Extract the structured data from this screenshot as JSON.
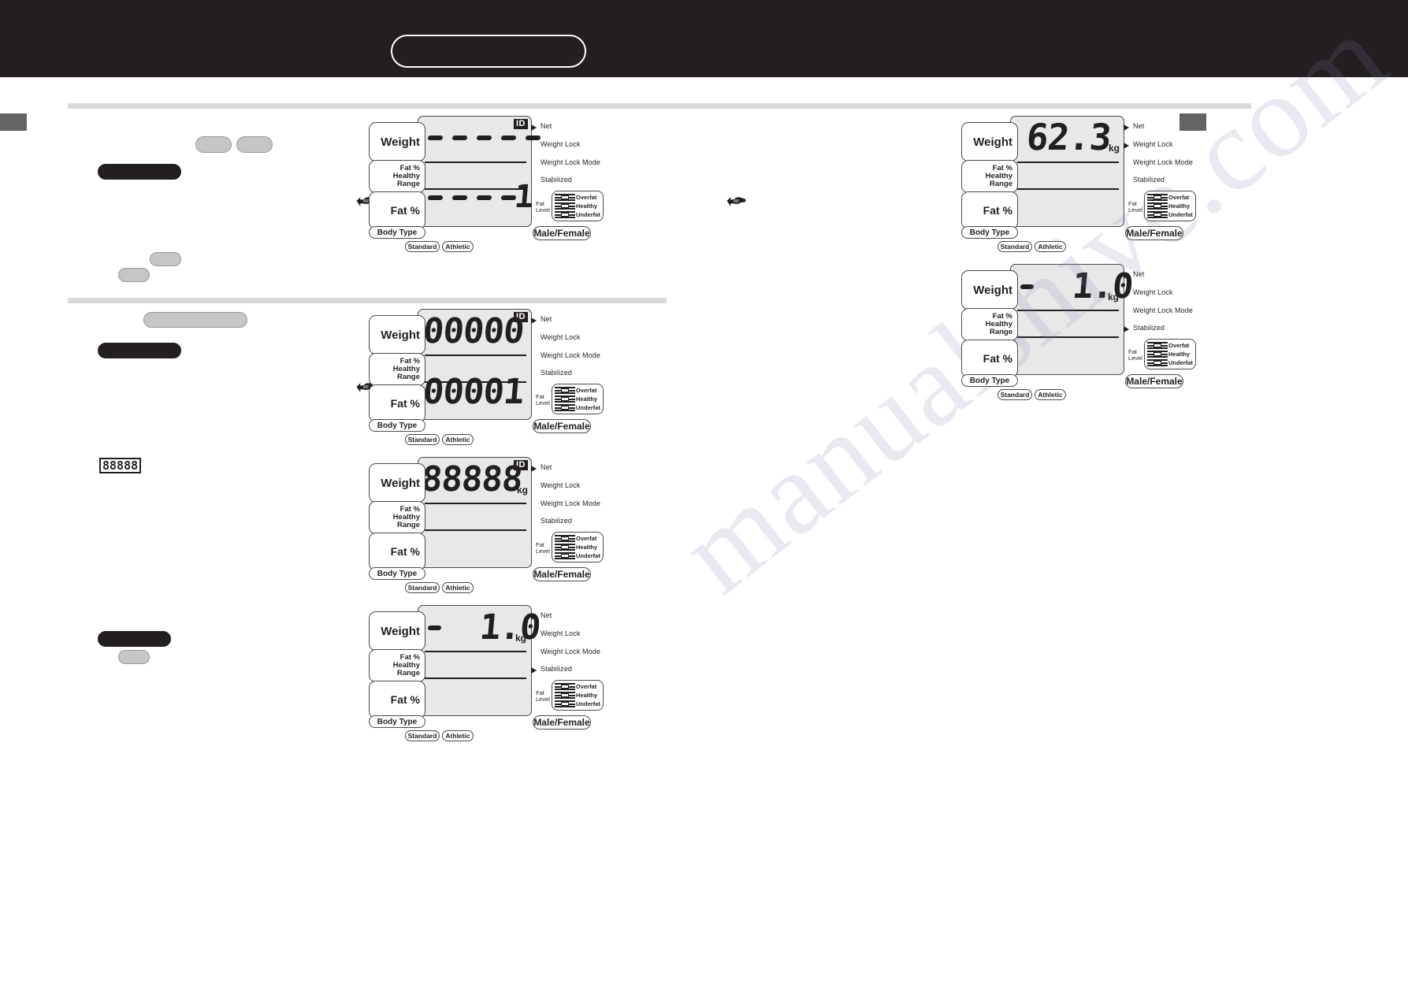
{
  "header": {
    "title": "",
    "title_box_label": "",
    "bg_color": "#231f20"
  },
  "page_marks": {
    "left_oval": "",
    "right_oval": "",
    "edge_tab_color": "#626365"
  },
  "watermark": {
    "text": "manualshive.com"
  },
  "icons": {
    "hand": "pointing-hand-icon",
    "mini_lcd": "88888"
  },
  "lcd_labels": {
    "weight": "Weight",
    "healthy_range": "Fat %\nHealthy Range",
    "healthy_range_line1": "Fat %",
    "healthy_range_line2": "Healthy Range",
    "fat_pct": "Fat %",
    "body_type": "Body Type",
    "standard": "Standard",
    "athletic": "Athletic",
    "male_female": "Male/Female",
    "net": "Net",
    "weight_lock": "Weight Lock",
    "weight_lock_mode": "Weight Lock Mode",
    "stabilized": "Stabilized",
    "fat_level_line1": "Fat",
    "fat_level_line2": "Level",
    "overfat": "Overfat",
    "healthy": "Healthy",
    "underfat": "Underfat",
    "id": "ID",
    "kg": "kg"
  },
  "panels": [
    {
      "id": "panel-dashes-1",
      "column": "left",
      "weight_display": "-----",
      "weight_unit": "",
      "fat_display": "----1",
      "id_badge": "ID",
      "arrows": [
        "net"
      ]
    },
    {
      "id": "panel-00000",
      "column": "left",
      "weight_display": "00000",
      "weight_unit": "",
      "fat_display": "00001",
      "id_badge": "ID",
      "arrows": [
        "net"
      ]
    },
    {
      "id": "panel-88888",
      "column": "left",
      "weight_display": "88888",
      "weight_unit": "kg",
      "fat_display": "",
      "id_badge": "ID",
      "arrows": [
        "net"
      ]
    },
    {
      "id": "panel-minus-1-0-left",
      "column": "left",
      "weight_display": "1.0",
      "weight_sign": "-",
      "weight_unit": "kg",
      "fat_display": "",
      "id_badge": "",
      "arrows": [
        "net",
        "stabilized"
      ]
    },
    {
      "id": "panel-62-3",
      "column": "right",
      "weight_display": "62.3",
      "weight_unit": "kg",
      "fat_display": "",
      "id_badge": "",
      "arrows": [
        "net",
        "weight_lock"
      ]
    },
    {
      "id": "panel-minus-1-0-right",
      "column": "right",
      "weight_display": "1.0",
      "weight_sign": "-",
      "weight_unit": "kg",
      "fat_display": "",
      "id_badge": "",
      "arrows": [
        "net",
        "stabilized"
      ]
    }
  ],
  "redactions": {
    "left_column": [
      {
        "name": "step-pill-a",
        "style": "light"
      },
      {
        "name": "step-pill-b",
        "style": "light"
      },
      {
        "name": "heading-bar-1",
        "style": "dark"
      },
      {
        "name": "note-pill-a",
        "style": "light"
      },
      {
        "name": "note-pill-b",
        "style": "light"
      },
      {
        "name": "section-pill-wide",
        "style": "light"
      },
      {
        "name": "heading-bar-2",
        "style": "dark"
      },
      {
        "name": "heading-bar-3",
        "style": "dark"
      },
      {
        "name": "note-pill-c",
        "style": "light"
      }
    ]
  }
}
